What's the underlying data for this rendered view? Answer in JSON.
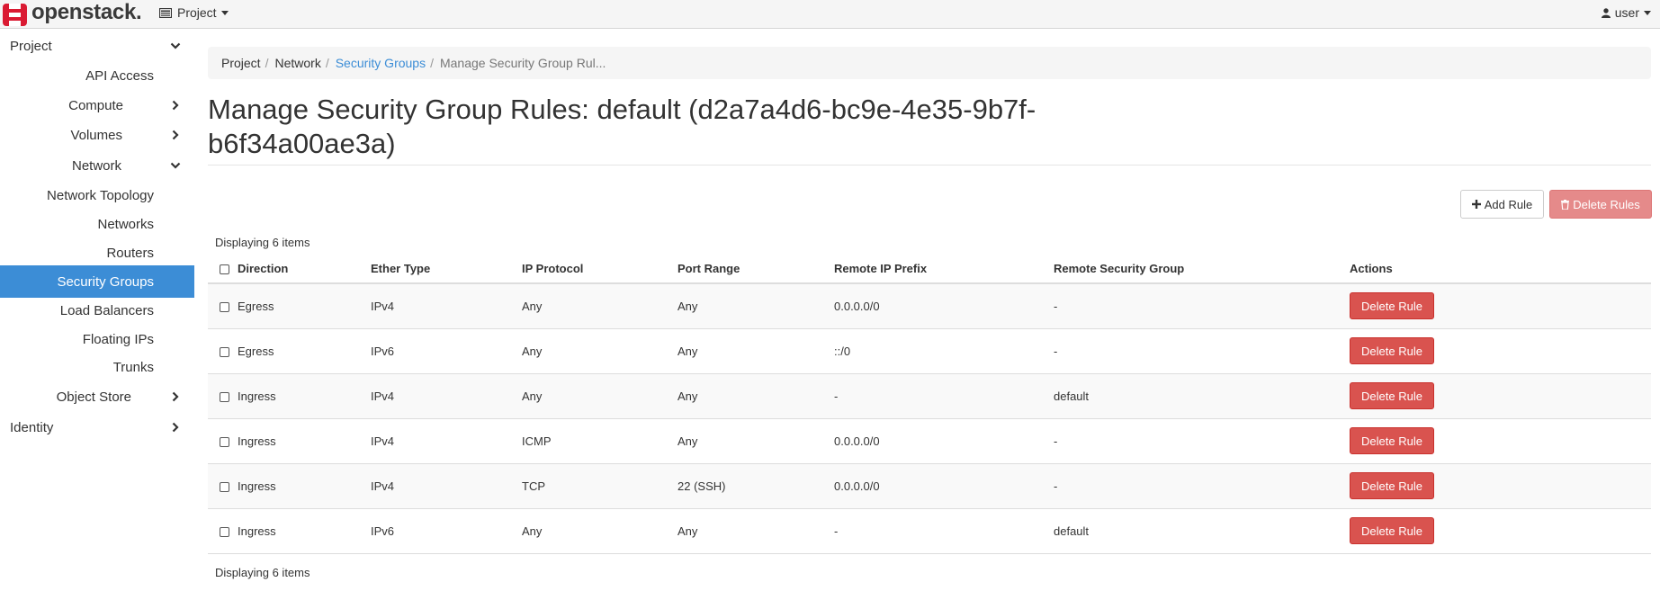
{
  "brand": {
    "name": "openstack",
    "dot": ".",
    "color": "#da1a32"
  },
  "topbar": {
    "project_menu": {
      "label": "Project",
      "icon": "grid-icon"
    },
    "user_menu": {
      "label": "user",
      "icon": "user-icon"
    }
  },
  "sidebar": {
    "active_color": "#3c8dd6",
    "items": [
      {
        "label": "Project",
        "chevron": "down",
        "active": false
      },
      {
        "label": "API Access",
        "chevron": "",
        "active": false
      },
      {
        "label": "Compute",
        "chevron": "right",
        "active": false
      },
      {
        "label": "Volumes",
        "chevron": "right",
        "active": false
      },
      {
        "label": "Network",
        "chevron": "down",
        "active": false
      },
      {
        "label": "Network Topology",
        "chevron": "",
        "active": false
      },
      {
        "label": "Networks",
        "chevron": "",
        "active": false
      },
      {
        "label": "Routers",
        "chevron": "",
        "active": false
      },
      {
        "label": "Security Groups",
        "chevron": "",
        "active": true
      },
      {
        "label": "Load Balancers",
        "chevron": "",
        "active": false
      },
      {
        "label": "Floating IPs",
        "chevron": "",
        "active": false
      },
      {
        "label": "Trunks",
        "chevron": "",
        "active": false
      },
      {
        "label": "Object Store",
        "chevron": "right",
        "active": false
      },
      {
        "label": "Identity",
        "chevron": "right",
        "active": false
      }
    ]
  },
  "breadcrumb": {
    "items": [
      "Project",
      "Network",
      "Security Groups",
      "Manage Security Group Rul..."
    ]
  },
  "page": {
    "title": "Manage Security Group Rules: default (d2a7a4d6-bc9e-4e35-9b7f-b6f34a00ae3a)"
  },
  "toolbar": {
    "add_rule_label": "Add Rule",
    "delete_rules_label": "Delete Rules"
  },
  "table": {
    "count_text": "Displaying 6 items",
    "columns": [
      "Direction",
      "Ether Type",
      "IP Protocol",
      "Port Range",
      "Remote IP Prefix",
      "Remote Security Group",
      "Actions"
    ],
    "rows": [
      {
        "direction": "Egress",
        "ether_type": "IPv4",
        "ip_protocol": "Any",
        "port_range": "Any",
        "remote_ip_prefix": "0.0.0.0/0",
        "remote_security_group": "-",
        "action": "Delete Rule"
      },
      {
        "direction": "Egress",
        "ether_type": "IPv6",
        "ip_protocol": "Any",
        "port_range": "Any",
        "remote_ip_prefix": "::/0",
        "remote_security_group": "-",
        "action": "Delete Rule"
      },
      {
        "direction": "Ingress",
        "ether_type": "IPv4",
        "ip_protocol": "Any",
        "port_range": "Any",
        "remote_ip_prefix": "-",
        "remote_security_group": "default",
        "action": "Delete Rule"
      },
      {
        "direction": "Ingress",
        "ether_type": "IPv4",
        "ip_protocol": "ICMP",
        "port_range": "Any",
        "remote_ip_prefix": "0.0.0.0/0",
        "remote_security_group": "-",
        "action": "Delete Rule"
      },
      {
        "direction": "Ingress",
        "ether_type": "IPv4",
        "ip_protocol": "TCP",
        "port_range": "22 (SSH)",
        "remote_ip_prefix": "0.0.0.0/0",
        "remote_security_group": "-",
        "action": "Delete Rule"
      },
      {
        "direction": "Ingress",
        "ether_type": "IPv6",
        "ip_protocol": "Any",
        "port_range": "Any",
        "remote_ip_prefix": "-",
        "remote_security_group": "default",
        "action": "Delete Rule"
      }
    ]
  }
}
